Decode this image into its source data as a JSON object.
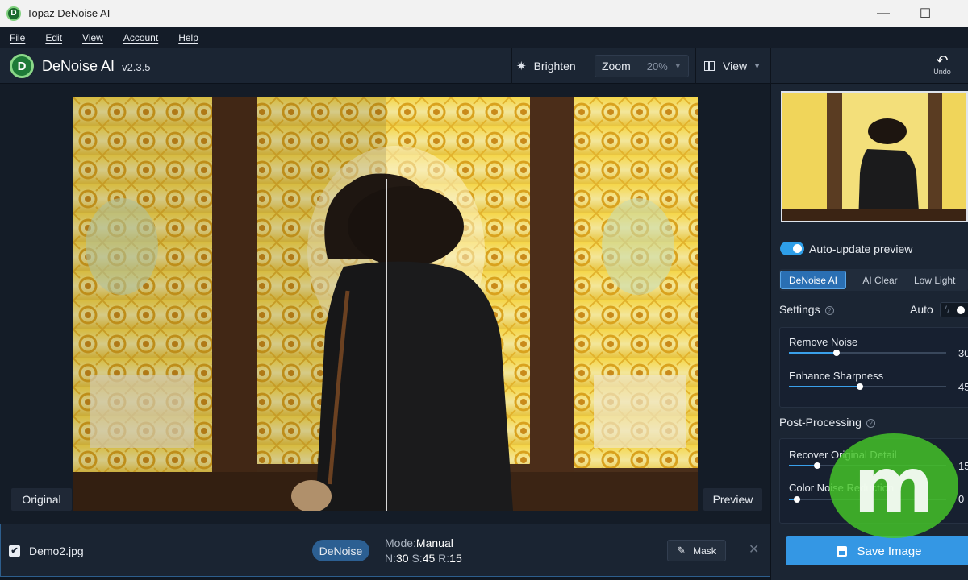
{
  "window": {
    "title": "Topaz DeNoise AI",
    "logo_letter": "D",
    "minimize_icon": "minimize-icon",
    "maximize_icon": "maximize-icon"
  },
  "menu": [
    "File",
    "Edit",
    "View",
    "Account",
    "Help"
  ],
  "toolbar": {
    "logo_letter": "D",
    "app_name": "DeNoise AI",
    "version": "v2.3.5",
    "brighten_label": "Brighten",
    "zoom_label": "Zoom",
    "zoom_value": "20%",
    "view_label": "View",
    "undo_label": "Undo"
  },
  "canvas": {
    "original_label": "Original",
    "preview_label": "Preview",
    "split_fraction": 0.5
  },
  "panel": {
    "auto_update_label": "Auto-update preview",
    "auto_update_on": true,
    "models": [
      {
        "label": "DeNoise AI",
        "active": true
      },
      {
        "label": "AI Clear",
        "active": false
      },
      {
        "label": "Low Light",
        "active": false
      }
    ],
    "settings_title": "Settings",
    "auto_label": "Auto",
    "settings_sliders": [
      {
        "label": "Remove Noise",
        "value": "30",
        "fraction": 0.3
      },
      {
        "label": "Enhance Sharpness",
        "value": "45",
        "fraction": 0.45
      }
    ],
    "post_title": "Post-Processing",
    "post_sliders": [
      {
        "label": "Recover Original Detail",
        "value": "15",
        "fraction": 0.18
      },
      {
        "label": "Color Noise Reduction",
        "value": "0",
        "fraction": 0.05
      }
    ],
    "save_label": "Save Image"
  },
  "bottom": {
    "filename": "Demo2.jpg",
    "checked": true,
    "badge": "DeNoise",
    "mode_key": "Mode:",
    "mode_value": "Manual",
    "n_key": "N:",
    "n_value": "30",
    "s_key": "S:",
    "s_value": "45",
    "r_key": "R:",
    "r_value": "15",
    "mask_label": "Mask"
  },
  "colors": {
    "accent": "#3497e4",
    "panel_bg": "#1b2533",
    "badge_bg": "#2c5f92"
  }
}
